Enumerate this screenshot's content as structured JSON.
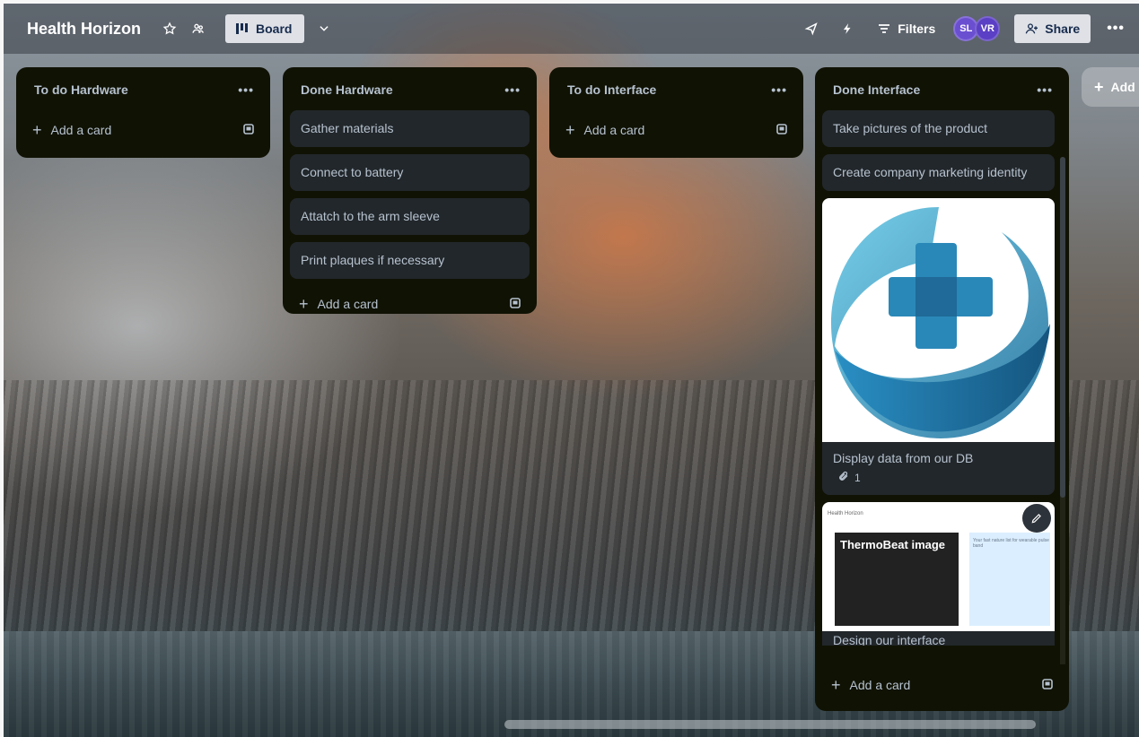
{
  "header": {
    "board_title": "Health Horizon",
    "view_label": "Board",
    "filters_label": "Filters",
    "share_label": "Share",
    "avatars": [
      "SL",
      "VR"
    ]
  },
  "lists": [
    {
      "title": "To do Hardware",
      "cards": [],
      "add_label": "Add a card"
    },
    {
      "title": "Done Hardware",
      "cards": [
        "Gather materials",
        "Connect to battery",
        "Attatch to the arm sleeve",
        "Print plaques if necessary"
      ],
      "add_label": "Add a card"
    },
    {
      "title": "To do Interface",
      "cards": [],
      "add_label": "Add a card"
    },
    {
      "title": "Done Interface",
      "cards": [
        "Take pictures of the product",
        "Create company marketing identity"
      ],
      "image_card": {
        "title": "Display data from our DB",
        "attachments": "1"
      },
      "image_card2": {
        "thumb_title": "ThermoBeat image",
        "thumb_caption": "Health Horizon",
        "thumb_side_text": "Your fast nature list for wearable pulse band",
        "peek_title": "Design our interface"
      },
      "add_label": "Add a card"
    }
  ],
  "add_list_label": "Add another list",
  "colors": {
    "list_bg": "#101204",
    "card_bg": "#22272b",
    "text": "#b6c2cf",
    "avatar_sl": "#6b4fd1",
    "avatar_vr": "#5b3fc4"
  }
}
